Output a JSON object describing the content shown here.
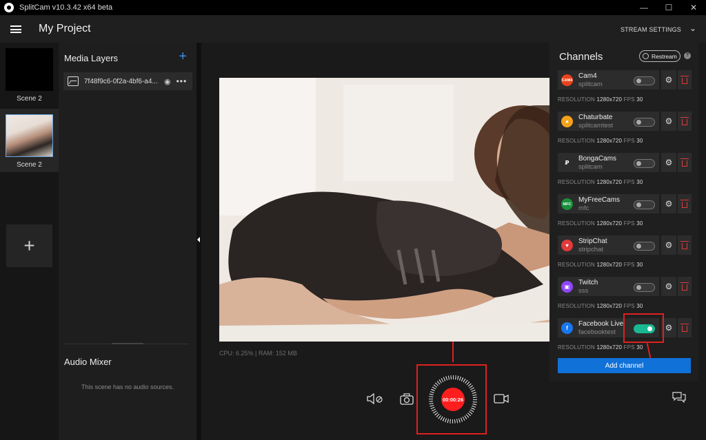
{
  "window": {
    "title": "SplitCam v10.3.42 x64 beta",
    "minimize": "—",
    "maximize": "☐",
    "close": "✕"
  },
  "header": {
    "project_title": "My Project",
    "stream_settings": "STREAM SETTINGS"
  },
  "scenes": [
    {
      "label": "Scene 2"
    },
    {
      "label": "Scene 2"
    }
  ],
  "media_layers": {
    "title": "Media Layers",
    "items": [
      {
        "name": "7f48f9c6-0f2a-4bf6-a4..."
      }
    ]
  },
  "audio_mixer": {
    "title": "Audio Mixer",
    "empty_text": "This scene has no audio sources."
  },
  "preview": {
    "stats": "CPU: 6.25% | RAM: 152 MB"
  },
  "controls": {
    "timer": "00:00:26"
  },
  "channels": {
    "title": "Channels",
    "restream_label": "Restream",
    "help": "?",
    "resolution_label": "RESOLUTION",
    "fps_label": "FPS",
    "add_channel": "Add channel",
    "items": [
      {
        "name": "Cam4",
        "user": "splitcam",
        "resolution": "1280x720",
        "fps": "30",
        "enabled": false,
        "logo": "cam4-logo",
        "logo_text": "CAM4",
        "logo_color": "#e8431c"
      },
      {
        "name": "Chaturbate",
        "user": "splitcamtest",
        "resolution": "1280x720",
        "fps": "30",
        "enabled": false,
        "logo": "chaturbate-logo",
        "logo_text": "●",
        "logo_color": "#f4a21c"
      },
      {
        "name": "BongaCams",
        "user": "splitcam",
        "resolution": "1280x720",
        "fps": "30",
        "enabled": false,
        "logo": "bongacams-logo",
        "logo_text": "Ꝑ",
        "logo_color": "#2c2c2c"
      },
      {
        "name": "MyFreeCams",
        "user": "mfc",
        "resolution": "1280x720",
        "fps": "30",
        "enabled": false,
        "logo": "myfreecams-logo",
        "logo_text": "MFC",
        "logo_color": "#1a8f3c"
      },
      {
        "name": "StripChat",
        "user": "stripchat",
        "resolution": "1280x720",
        "fps": "30",
        "enabled": false,
        "logo": "stripchat-logo",
        "logo_text": "♥",
        "logo_color": "#e23a3a"
      },
      {
        "name": "Twitch",
        "user": "sss",
        "resolution": "1280x720",
        "fps": "30",
        "enabled": false,
        "logo": "twitch-logo",
        "logo_text": "▣",
        "logo_color": "#9146ff"
      },
      {
        "name": "Facebook Live",
        "user": "facebooktest",
        "resolution": "1280x720",
        "fps": "30",
        "enabled": true,
        "logo": "facebook-logo",
        "logo_text": "f",
        "logo_color": "#1877f2"
      }
    ]
  },
  "colors": {
    "accent": "#1071d8",
    "record": "#ff1e1e",
    "toggle_on": "#19b892",
    "highlight": "#e02020"
  }
}
